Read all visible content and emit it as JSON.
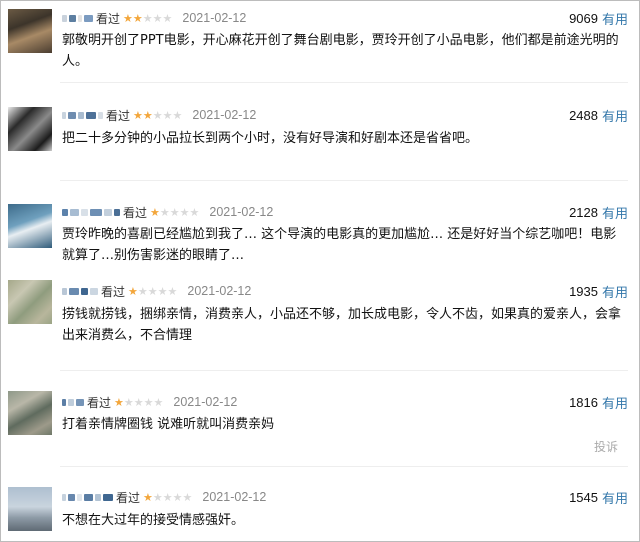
{
  "comments": [
    {
      "watched_label": "看过",
      "rating": 2,
      "date": "2021-02-12",
      "votes": "9069",
      "useful_label": "有用",
      "text": "郭敬明开创了PPT电影，开心麻花开创了舞台剧电影，贾玲开创了小品电影，他们都是前途光明的人。"
    },
    {
      "watched_label": "看过",
      "rating": 2,
      "date": "2021-02-12",
      "votes": "2488",
      "useful_label": "有用",
      "text": "把二十多分钟的小品拉长到两个小时，没有好导演和好剧本还是省省吧。"
    },
    {
      "watched_label": "看过",
      "rating": 1,
      "date": "2021-02-12",
      "votes": "2128",
      "useful_label": "有用",
      "text": "贾玲昨晚的喜剧已经尴尬到我了… 这个导演的电影真的更加尴尬… 还是好好当个综艺咖吧！电影就算了…别伤害影迷的眼睛了…"
    },
    {
      "watched_label": "看过",
      "rating": 1,
      "date": "2021-02-12",
      "votes": "1935",
      "useful_label": "有用",
      "text": "捞钱就捞钱，捆绑亲情，消费亲人，小品还不够，加长成电影，令人不齿，如果真的爱亲人，会拿出来消费么，不合情理"
    },
    {
      "watched_label": "看过",
      "rating": 1,
      "date": "2021-02-12",
      "votes": "1816",
      "useful_label": "有用",
      "text": "打着亲情牌圈钱 说难听就叫消费亲妈",
      "report_label": "投诉"
    },
    {
      "watched_label": "看过",
      "rating": 1,
      "date": "2021-02-12",
      "votes": "1545",
      "useful_label": "有用",
      "text": "不想在大过年的接受情感强奸。"
    }
  ],
  "colors": {
    "star_on": "#f3a63b",
    "star_off": "#d9d9d9",
    "useful_link": "#3377aa",
    "date": "#888888"
  }
}
